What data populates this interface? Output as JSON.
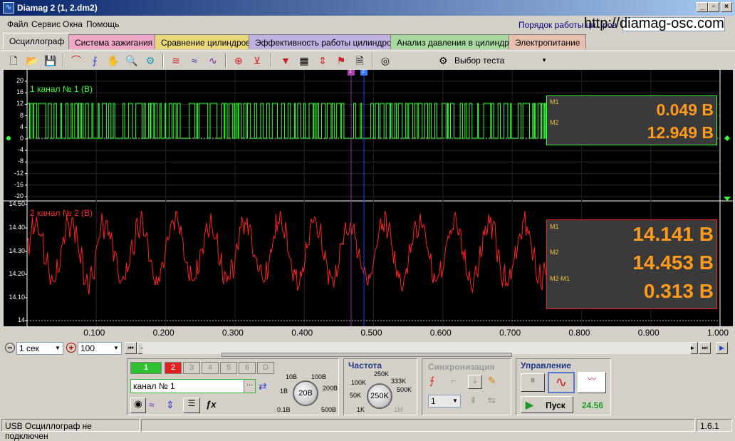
{
  "window": {
    "title": "Diamag 2 (1, 2.dm2)",
    "app_icon": "waveform-icon",
    "controls": [
      "_",
      "ð",
      "X"
    ]
  },
  "menu": {
    "items": [
      "Файл",
      "Сервис",
      "Окна",
      "Помощь"
    ],
    "order_text": "Порядок работы ци...ров",
    "url": "http://diamag-osc.com"
  },
  "tabs": [
    {
      "label": "Осциллограф",
      "color": "#d4d0c8",
      "active": true
    },
    {
      "label": "Система зажигания",
      "color": "#f0a8c8"
    },
    {
      "label": "Сравнение цилиндров",
      "color": "#e8d87a"
    },
    {
      "label": "Эффективность работы цилиндров",
      "color": "#c0b0e0"
    },
    {
      "label": "Анализ давления в цилиндре",
      "color": "#a8d8a0"
    },
    {
      "label": "Электропитание",
      "color": "#e8c0b0"
    }
  ],
  "toolbar": {
    "test_select": "Выбор теста"
  },
  "scope": {
    "cursor_labels": [
      "1",
      "2"
    ],
    "channel1": {
      "label": "1 канал № 1 (В)",
      "color": "#33ff33",
      "y_ticks": [
        "20",
        "16",
        "12",
        "8",
        "4",
        "0",
        "-4",
        "-8",
        "-12",
        "-16",
        "-20"
      ],
      "measure": {
        "m1_label": "M1",
        "m2_label": "M2",
        "m1_value": "0.049 В",
        "m2_value": "12.949 В"
      }
    },
    "channel2": {
      "label": "2 канал № 2 (В)",
      "color": "#ff2222",
      "y_ticks": [
        "14.50",
        "14.40",
        "14.30",
        "14.20",
        "14.10",
        "14"
      ],
      "measure": {
        "m1_label": "M1",
        "m2_label": "M2",
        "diff_label": "M2-M1",
        "m1_value": "14.141 В",
        "m2_value": "14.453 В",
        "diff_value": "0.313 В"
      }
    },
    "x_ticks": [
      "0.100",
      "0.200",
      "0.300",
      "0.400",
      "0.500",
      "0.600",
      "0.700",
      "0.800",
      "0.900",
      "1.000"
    ]
  },
  "nav": {
    "timebase": "1 сек",
    "points": "100"
  },
  "control": {
    "channel_buttons": [
      "1",
      "2",
      "3",
      "4",
      "5",
      "6",
      "D"
    ],
    "channel_name": "канал № 1",
    "range_labels": [
      "10В",
      "100В",
      "1В",
      "200В",
      "0.1В",
      "500В"
    ],
    "range_value": "20В",
    "freq_title": "Частота",
    "freq_labels": [
      "250K",
      "100K",
      "333K",
      "50K",
      "500K",
      "1K",
      "1M"
    ],
    "freq_value": "250K",
    "sync_title": "Синхронизация",
    "sync_value": "1",
    "control_title": "Управление",
    "start_label": "Пуск",
    "voltage": "24.56"
  },
  "status": {
    "message": "USB Осциллограф не подключен",
    "version": "1.6.1"
  }
}
